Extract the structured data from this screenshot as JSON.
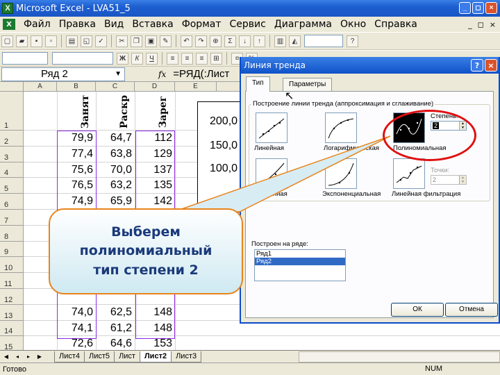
{
  "window": {
    "title": "Microsoft Excel - LVA51_5",
    "app_icon": "X"
  },
  "menu": {
    "items": [
      "Файл",
      "Правка",
      "Вид",
      "Вставка",
      "Формат",
      "Сервис",
      "Диаграмма",
      "Окно",
      "Справка"
    ],
    "right": [
      "_",
      "◻",
      "×"
    ]
  },
  "formula_bar": {
    "name": "Ряд 2",
    "fx": "fx",
    "formula": "=РЯД(:Лист"
  },
  "sheet": {
    "columns": [
      "A",
      "B",
      "C",
      "D",
      "E"
    ],
    "rows": [
      "1",
      "2",
      "3",
      "4",
      "5",
      "6",
      "7",
      "8",
      "9",
      "10",
      "11",
      "12",
      "13",
      "14",
      "15",
      "16"
    ],
    "vertical_headers": [
      "Занят",
      "Раскр",
      "Зарег"
    ],
    "data_rows": [
      [
        "79,9",
        "64,7",
        "112"
      ],
      [
        "77,4",
        "63,8",
        "129"
      ],
      [
        "75,6",
        "70,0",
        "137"
      ],
      [
        "76,5",
        "63,2",
        "135"
      ],
      [
        "74,9",
        "65,9",
        "142"
      ]
    ],
    "data_rows_bottom": [
      [
        "74,0",
        "62,5",
        "148"
      ],
      [
        "74,1",
        "61,2",
        "148"
      ],
      [
        "72,6",
        "64,6",
        "153"
      ],
      [
        "70,9",
        "69,2",
        "156"
      ]
    ],
    "chart_axis_labels": [
      "200,0",
      "150,0",
      "100,0"
    ]
  },
  "sheet_tabs": {
    "tabs": [
      "Лист4",
      "Лист5",
      "Лист",
      "Лист2",
      "Лист3"
    ],
    "active_index": 3
  },
  "status": {
    "left": "Готово",
    "num": "NUM"
  },
  "dialog": {
    "title": "Линия тренда",
    "help": "?",
    "close": "×",
    "tabs": [
      "Тип",
      "Параметры"
    ],
    "group_title": "Построение линии тренда (аппроксимация и сглаживание)",
    "types": [
      "Линейная",
      "Логарифмическая",
      "Полиномиальная",
      "Степенная",
      "Экспоненциальная",
      "Линейная фильтрация"
    ],
    "degree_label": "Степень:",
    "degree_value": "2",
    "points_label": "Точки:",
    "points_value": "2",
    "series_label": "Построен на ряде:",
    "series": [
      "Ряд1",
      "Ряд2"
    ],
    "ok": "ОК",
    "cancel": "Отмена"
  },
  "callout": {
    "text": "Выберем\nполиномиальный\nтип степени 2"
  }
}
